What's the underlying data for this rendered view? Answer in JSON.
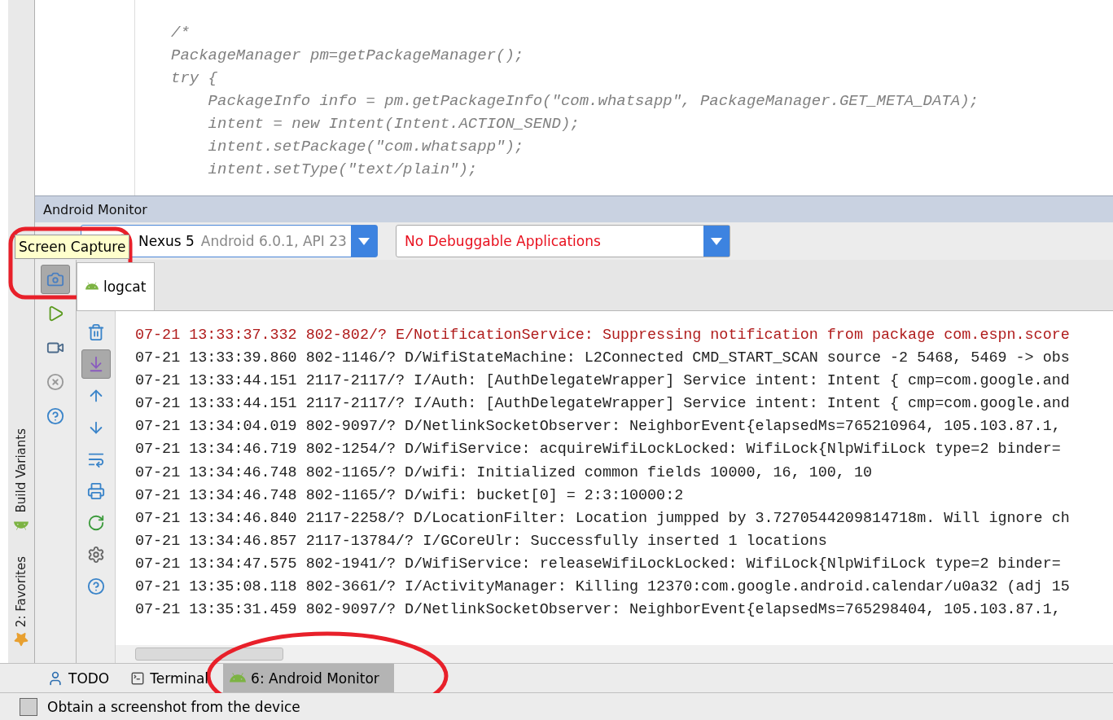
{
  "side_tabs": [
    {
      "label": "Build Variants",
      "kind": "android"
    },
    {
      "label": "2: Favorites",
      "kind": "star"
    }
  ],
  "editor": {
    "lines": [
      "/*",
      "PackageManager pm=getPackageManager();",
      "try {",
      "    PackageInfo info = pm.getPackageInfo(\"com.whatsapp\", PackageManager.GET_META_DATA);",
      "    intent = new Intent(Intent.ACTION_SEND);",
      "    intent.setPackage(\"com.whatsapp\");",
      "    intent.setType(\"text/plain\");"
    ]
  },
  "monitor": {
    "title": "Android Monitor",
    "device": {
      "name": "Nexus 5",
      "detail": "Android 6.0.1, API 23"
    },
    "app_select": {
      "value": "No Debuggable Applications"
    },
    "tooltip": "Screen Capture",
    "left_tools": [
      {
        "selected": true
      },
      {
        "selected": false
      },
      {
        "selected": false
      },
      {
        "selected": false
      },
      {
        "selected": false
      }
    ],
    "tabs": [
      {
        "label": "logcat",
        "selected": true
      }
    ],
    "log_tools": [
      {
        "selected": false
      },
      {
        "selected": true
      },
      {
        "selected": false
      },
      {
        "selected": false
      },
      {
        "selected": false
      },
      {
        "selected": false
      },
      {
        "selected": false
      },
      {
        "selected": false
      },
      {
        "selected": false
      }
    ],
    "log_rows": [
      {
        "kind": "error",
        "text": "07-21 13:33:37.332 802-802/? E/NotificationService: Suppressing notification from package com.espn.score"
      },
      {
        "kind": "normal",
        "text": "07-21 13:33:39.860 802-1146/? D/WifiStateMachine: L2Connected CMD_START_SCAN source -2 5468, 5469 -> obs"
      },
      {
        "kind": "normal",
        "text": "07-21 13:33:44.151 2117-2117/? I/Auth: [AuthDelegateWrapper] Service intent: Intent { cmp=com.google.and"
      },
      {
        "kind": "normal",
        "text": "07-21 13:33:44.151 2117-2117/? I/Auth: [AuthDelegateWrapper] Service intent: Intent { cmp=com.google.and"
      },
      {
        "kind": "normal",
        "text": "07-21 13:34:04.019 802-9097/? D/NetlinkSocketObserver: NeighborEvent{elapsedMs=765210964, 105.103.87.1,"
      },
      {
        "kind": "normal",
        "text": "07-21 13:34:46.719 802-1254/? D/WifiService: acquireWifiLockLocked: WifiLock{NlpWifiLock type=2 binder="
      },
      {
        "kind": "normal",
        "text": "07-21 13:34:46.748 802-1165/? D/wifi: Initialized common fields 10000, 16, 100, 10"
      },
      {
        "kind": "normal",
        "text": "07-21 13:34:46.748 802-1165/? D/wifi: bucket[0] = 2:3:10000:2"
      },
      {
        "kind": "normal",
        "text": "07-21 13:34:46.840 2117-2258/? D/LocationFilter: Location jumpped by 3.7270544209814718m. Will ignore ch"
      },
      {
        "kind": "normal",
        "text": "07-21 13:34:46.857 2117-13784/? I/GCoreUlr: Successfully inserted 1 locations"
      },
      {
        "kind": "normal",
        "text": "07-21 13:34:47.575 802-1941/? D/WifiService: releaseWifiLockLocked: WifiLock{NlpWifiLock type=2 binder="
      },
      {
        "kind": "normal",
        "text": "07-21 13:35:08.118 802-3661/? I/ActivityManager: Killing 12370:com.google.android.calendar/u0a32 (adj 15"
      },
      {
        "kind": "normal",
        "text": "07-21 13:35:31.459 802-9097/? D/NetlinkSocketObserver: NeighborEvent{elapsedMs=765298404, 105.103.87.1,"
      }
    ]
  },
  "bottom_tabs": [
    {
      "label": "TODO",
      "selected": false,
      "kind": "todo"
    },
    {
      "label": "Terminal",
      "selected": false,
      "kind": "terminal"
    },
    {
      "label": "6: Android Monitor",
      "selected": true,
      "kind": "android"
    }
  ],
  "status": "Obtain a screenshot from the device"
}
